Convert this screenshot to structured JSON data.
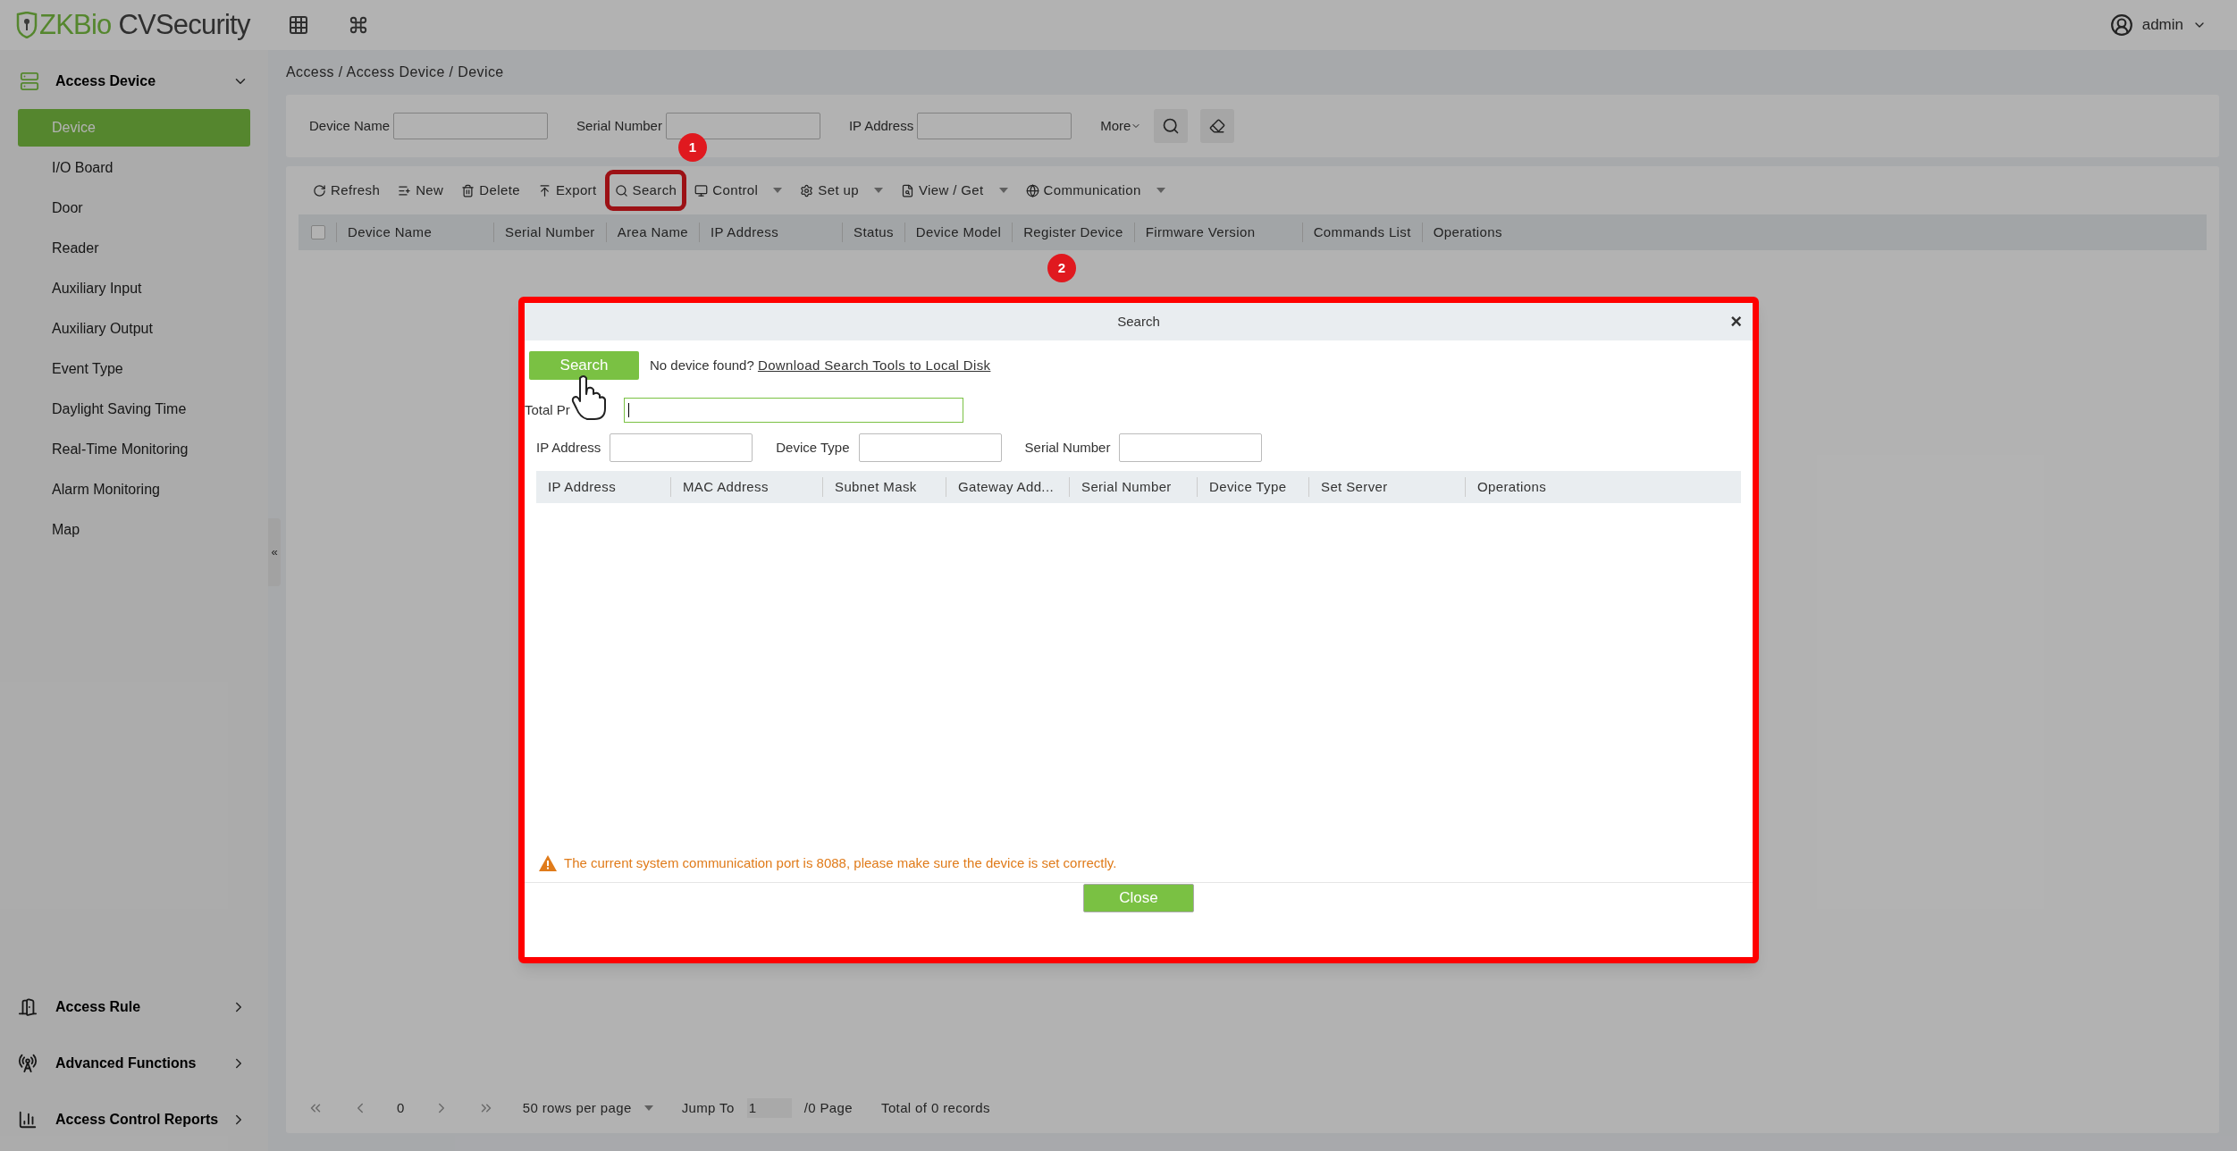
{
  "header": {
    "logo_brand": "ZKBio",
    "logo_product": " CVSecurity",
    "user": "admin"
  },
  "sidebar": {
    "section": {
      "label": "Access Device",
      "expanded": true
    },
    "items": [
      {
        "label": "Device",
        "selected": true
      },
      {
        "label": "I/O Board",
        "selected": false
      },
      {
        "label": "Door",
        "selected": false
      },
      {
        "label": "Reader",
        "selected": false
      },
      {
        "label": "Auxiliary Input",
        "selected": false
      },
      {
        "label": "Auxiliary Output",
        "selected": false
      },
      {
        "label": "Event Type",
        "selected": false
      },
      {
        "label": "Daylight Saving Time",
        "selected": false
      },
      {
        "label": "Real-Time Monitoring",
        "selected": false
      },
      {
        "label": "Alarm Monitoring",
        "selected": false
      },
      {
        "label": "Map",
        "selected": false
      }
    ],
    "bottom_sections": [
      {
        "label": "Access Rule",
        "kind": "door"
      },
      {
        "label": "Advanced Functions",
        "kind": "signal"
      },
      {
        "label": "Access Control Reports",
        "kind": "chart"
      }
    ],
    "collapse": "«"
  },
  "breadcrumb": "Access / Access Device / Device",
  "filters": {
    "fields": [
      "Device Name",
      "Serial Number",
      "IP Address"
    ],
    "more": "More"
  },
  "toolbar": [
    {
      "label": "Refresh",
      "kind": "refresh",
      "dropdown": false,
      "highlighted": false
    },
    {
      "label": "New",
      "kind": "new",
      "dropdown": false,
      "highlighted": false
    },
    {
      "label": "Delete",
      "kind": "delete",
      "dropdown": false,
      "highlighted": false
    },
    {
      "label": "Export",
      "kind": "export",
      "dropdown": false,
      "highlighted": false
    },
    {
      "label": "Search",
      "kind": "search",
      "dropdown": false,
      "highlighted": true
    },
    {
      "label": "Control",
      "kind": "monitor",
      "dropdown": true,
      "highlighted": false
    },
    {
      "label": "Set up",
      "kind": "gear",
      "dropdown": true,
      "highlighted": false
    },
    {
      "label": "View / Get",
      "kind": "view",
      "dropdown": true,
      "highlighted": false
    },
    {
      "label": "Communication",
      "kind": "globe",
      "dropdown": true,
      "highlighted": false
    }
  ],
  "table": {
    "select_all": {
      "checked": false
    },
    "columns": [
      "Device Name",
      "Serial Number",
      "Area Name",
      "IP Address",
      "Status",
      "Device Model",
      "Register Device",
      "Firmware Version",
      "Commands List",
      "Operations"
    ]
  },
  "pagination": {
    "page": "0",
    "rows_per_page": "50 rows per page",
    "jump_label": "Jump To",
    "jump_value": "1",
    "pages": "/0 Page",
    "total": "Total of 0 records"
  },
  "annotations": [
    {
      "label": "1"
    },
    {
      "label": "2"
    }
  ],
  "dialog": {
    "title": "Search",
    "close": "×",
    "search_button": "Search",
    "hint": "No device found?",
    "link": "Download Search Tools to Local Disk",
    "progress_label": "Total Pr",
    "fields": [
      "IP Address",
      "Device Type",
      "Serial Number"
    ],
    "columns": [
      "IP Address",
      "MAC Address",
      "Subnet Mask",
      "Gateway Add...",
      "Serial Number",
      "Device Type",
      "Set Server",
      "Operations"
    ],
    "warning": "The current system communication port is 8088, please make sure the device is set correctly.",
    "close_button": "Close"
  }
}
